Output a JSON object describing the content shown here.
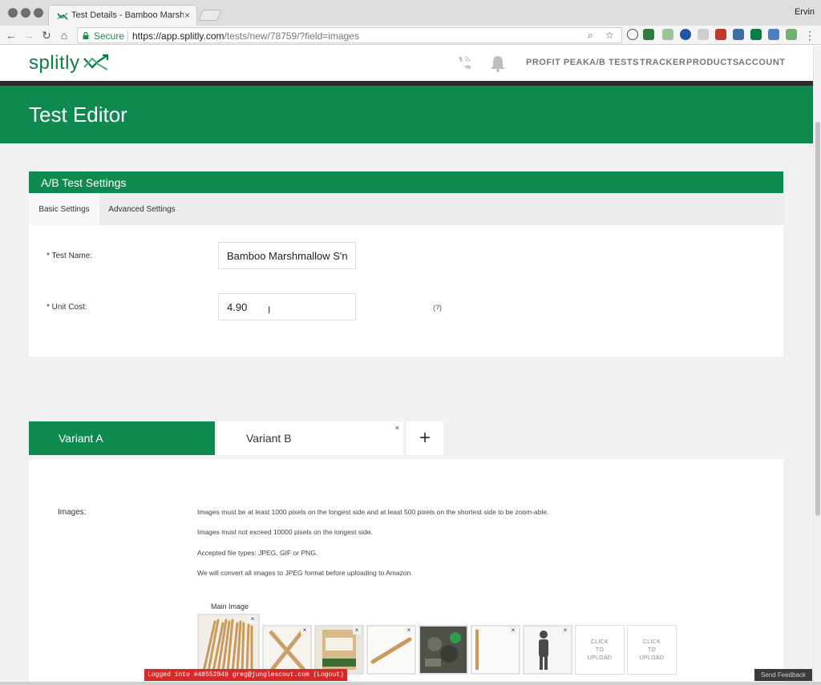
{
  "browser": {
    "tab_title": "Test Details - Bamboo Marshma",
    "tab_close": "×",
    "profile": "Ervin",
    "secure_label": "Secure",
    "url_host": "https://app.splitly.com",
    "url_path": "/tests/new/78759/?field=images",
    "icons": [
      "back-icon",
      "forward-icon",
      "reload-icon",
      "home-icon",
      "zoom-icon",
      "star-icon"
    ]
  },
  "header": {
    "logo": "splitly",
    "nav": [
      "PROFIT PEAK",
      "A/B TESTS",
      "TRACKER",
      "PRODUCTS",
      "ACCOUNT"
    ],
    "icons": [
      "phone-icon",
      "bell-icon"
    ]
  },
  "page": {
    "title": "Test Editor"
  },
  "settings": {
    "heading": "A/B Test Settings",
    "tabs": [
      "Basic Settings",
      "Advanced Settings"
    ],
    "test_name_label": "* Test Name:",
    "test_name_value": "Bamboo Marshmallow S'n",
    "unit_cost_label": "* Unit Cost:",
    "unit_cost_value": "4.90",
    "help": "(?)"
  },
  "variants": {
    "tabs": [
      "Variant A",
      "Variant B"
    ],
    "close": "×",
    "add": "+"
  },
  "images": {
    "label": "Images:",
    "rules": [
      "Images must be at least 1000 pixels on the longest side and at least 500 pixels on the shortest side to be zoom-able.",
      "Images must not exceed 10000 pixels on the longest side.",
      "Accepted file types: JPEG, GIF or PNG.",
      "We will convert all images to JPEG format before uploading to Amazon."
    ],
    "main_label": "Main Image",
    "remove": "×",
    "upload_lines": [
      "CLICK",
      "TO",
      "UPLOAD"
    ]
  },
  "footer": {
    "logged_in": "Logged into #48552849 greg@junglescout.com (Logout)",
    "feedback": "Send Feedback"
  },
  "colors": {
    "brand_green": "#0f8a4f",
    "logged_banner": "#d52a2a"
  }
}
